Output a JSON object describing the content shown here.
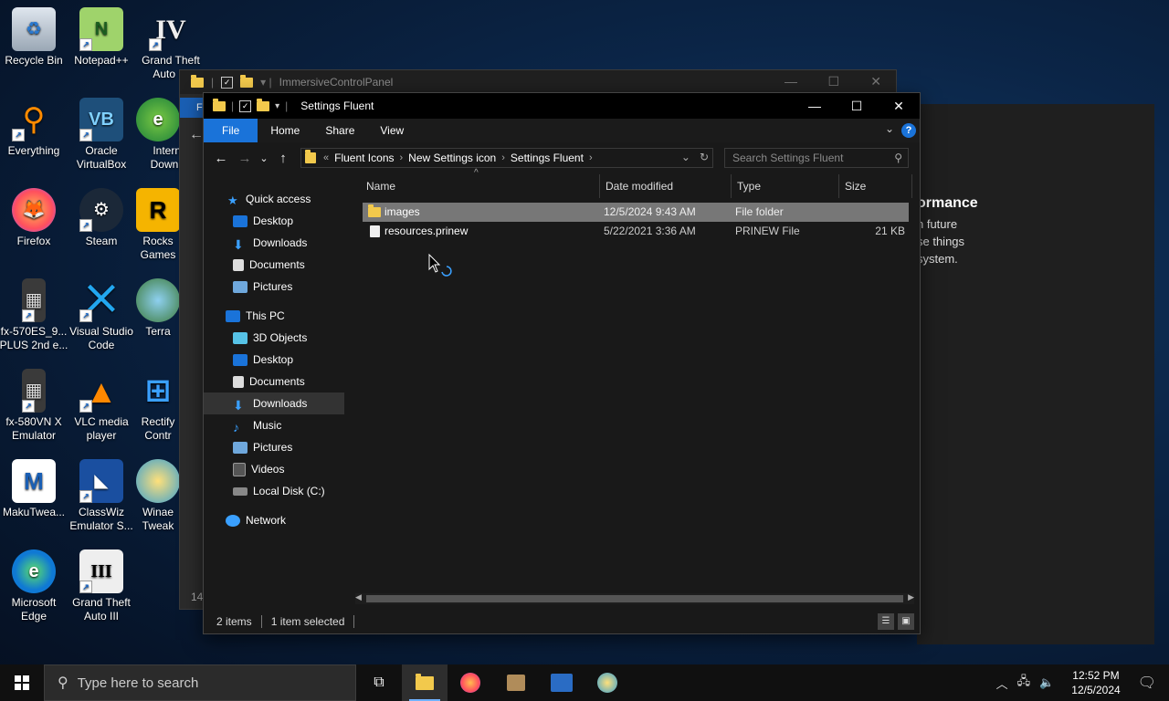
{
  "desktop": {
    "icons": [
      {
        "label": "Recycle Bin"
      },
      {
        "label": "Notepad++"
      },
      {
        "label": "Grand Theft Auto IV"
      },
      {
        "label": "Everything"
      },
      {
        "label": "Oracle VirtualBox"
      },
      {
        "label": "Intern Downl"
      },
      {
        "label": "Firefox"
      },
      {
        "label": "Steam"
      },
      {
        "label": "Rocks Games"
      },
      {
        "label": "fx-570ES_9... PLUS 2nd e..."
      },
      {
        "label": "Visual Studio Code"
      },
      {
        "label": "Terra"
      },
      {
        "label": "fx-580VN X Emulator"
      },
      {
        "label": "VLC media player"
      },
      {
        "label": "Rectify Contr"
      },
      {
        "label": "MakuTwea..."
      },
      {
        "label": "ClassWiz Emulator S..."
      },
      {
        "label": "Winae Tweak"
      },
      {
        "label": "Microsoft Edge"
      },
      {
        "label": "Grand Theft Auto III"
      }
    ]
  },
  "background_window": {
    "title": "ImmersiveControlPanel",
    "file_tab": "F",
    "corner_number": "14"
  },
  "settings_panel": {
    "heading": "ormance",
    "lines": [
      "n future",
      "se things",
      "system."
    ]
  },
  "explorer": {
    "title": "Settings Fluent",
    "ribbon_tabs": {
      "file": "File",
      "home": "Home",
      "share": "Share",
      "view": "View"
    },
    "address": {
      "overflow": "«",
      "crumbs": [
        "Fluent Icons",
        "New Settings icon",
        "Settings Fluent"
      ]
    },
    "search_placeholder": "Search Settings Fluent",
    "nav": {
      "quick_access": "Quick access",
      "qa_desktop": "Desktop",
      "qa_downloads": "Downloads",
      "qa_documents": "Documents",
      "qa_pictures": "Pictures",
      "this_pc": "This PC",
      "objects3d": "3D Objects",
      "desktop": "Desktop",
      "documents": "Documents",
      "downloads": "Downloads",
      "music": "Music",
      "pictures": "Pictures",
      "videos": "Videos",
      "local_disk": "Local Disk (C:)",
      "network": "Network"
    },
    "columns": {
      "name": "Name",
      "date": "Date modified",
      "type": "Type",
      "size": "Size"
    },
    "files": [
      {
        "name": "images",
        "date": "12/5/2024 9:43 AM",
        "type": "File folder",
        "size": ""
      },
      {
        "name": "resources.prinew",
        "date": "5/22/2021 3:36 AM",
        "type": "PRINEW File",
        "size": "21 KB"
      }
    ],
    "status": {
      "count": "2 items",
      "selected": "1 item selected"
    }
  },
  "taskbar": {
    "search_placeholder": "Type here to search",
    "time": "12:52 PM",
    "date": "12/5/2024"
  },
  "colors": {
    "accent": "#1a73d9",
    "selection": "#777777",
    "folder": "#f2c94c"
  }
}
